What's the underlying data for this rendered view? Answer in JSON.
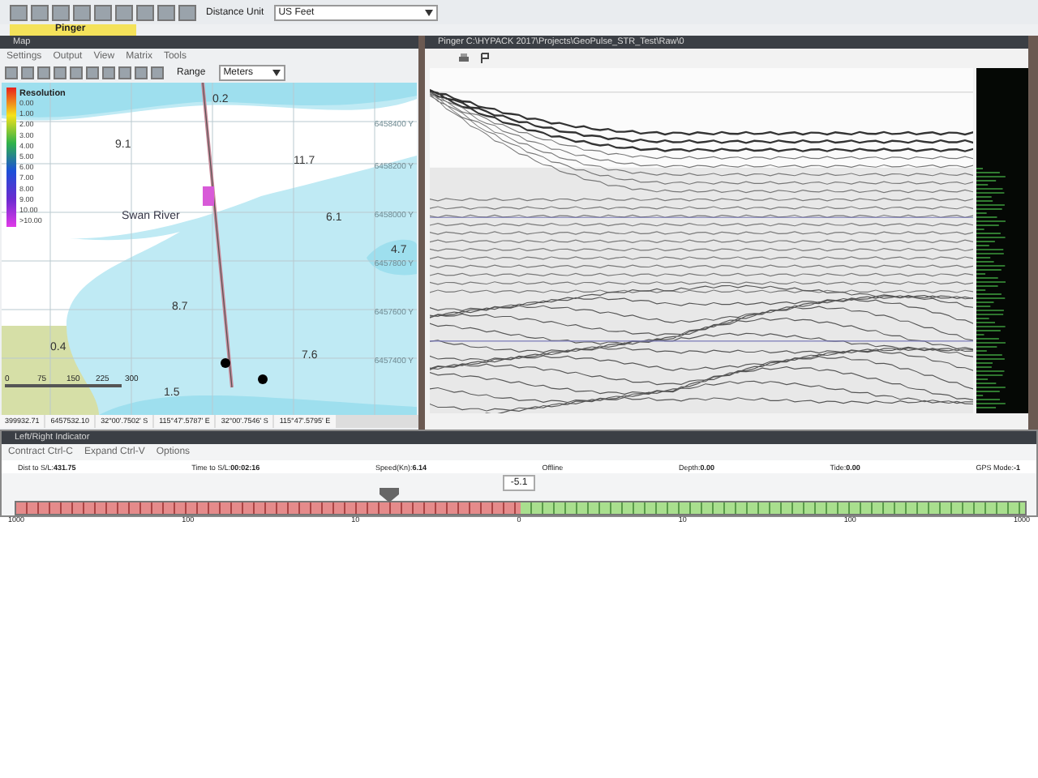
{
  "toolbar": {
    "distance_unit_label": "Distance Unit",
    "distance_unit": "US Feet"
  },
  "tab": {
    "label": "Pinger"
  },
  "map_window": {
    "title": "Map",
    "menu": [
      "Settings",
      "Output",
      "View",
      "Matrix",
      "Tools"
    ],
    "range_label": "Range",
    "range_value": "Meters",
    "legend": {
      "title": "Resolution",
      "values": [
        "0.00",
        "1.00",
        "2.00",
        "3.00",
        "4.00",
        "5.00",
        "6.00",
        "7.00",
        "8.00",
        "9.00",
        "10.00",
        ">10.00"
      ]
    },
    "depth_labels": [
      "0.2",
      "9.1",
      "11.7",
      "6.1",
      "4.7",
      "8.7",
      "0.4",
      "7.6",
      "1.5"
    ],
    "place_label": "Swan River",
    "grid_labels": [
      "6458400 Y",
      "6458200 Y",
      "6458000 Y",
      "6457800 Y",
      "6457600 Y",
      "6457400 Y"
    ],
    "scale_labels": [
      "0",
      "75",
      "150",
      "225",
      "300"
    ],
    "status": [
      "399932.71",
      "6457532.10",
      "32°00'.7502' S",
      "115°47'.5787' E",
      "32°00'.7546' S",
      "115°47'.5795' E"
    ]
  },
  "pinger_window": {
    "title": "Pinger C:\\HYPACK 2017\\Projects\\GeoPulse_STR_Test\\Raw\\0"
  },
  "indicator": {
    "title": "Left/Right Indicator",
    "menu": [
      "Contract Ctrl-C",
      "Expand Ctrl-V",
      "Options"
    ],
    "stats": [
      {
        "label": "Dist to S/L:",
        "value": "431.75"
      },
      {
        "label": "Time to S/L:",
        "value": "00:02:16"
      },
      {
        "label": "Speed(Kn):",
        "value": "6.14"
      },
      {
        "label": "Offline"
      },
      {
        "label": "Depth:",
        "value": "0.00"
      },
      {
        "label": "Tide:",
        "value": "0.00"
      },
      {
        "label": "GPS Mode:",
        "value": "-1"
      }
    ],
    "reading": "-5.1",
    "level": 0.37,
    "scale": [
      "1000",
      "100",
      "10",
      "0",
      "10",
      "100",
      "1000"
    ]
  }
}
